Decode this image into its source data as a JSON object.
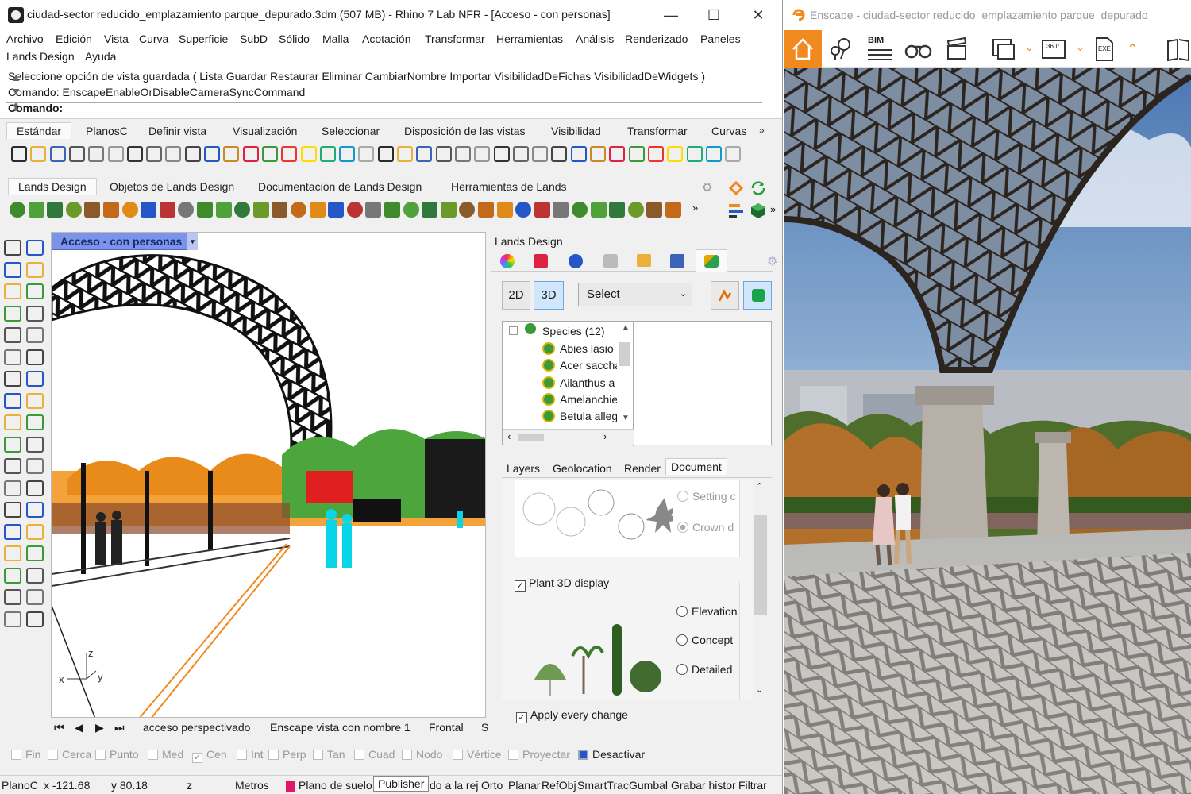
{
  "rhino": {
    "title": "ciudad-sector reducido_emplazamiento parque_depurado.3dm (507 MB) - Rhino 7 Lab NFR - [Acceso - con personas]",
    "window_controls": {
      "minimize": "—",
      "maximize": "☐",
      "close": "✕"
    },
    "menu": [
      "Archivo",
      "Edición",
      "Vista",
      "Curva",
      "Superficie",
      "SubD",
      "Sólido",
      "Malla",
      "Acotación",
      "Transformar",
      "Herramientas",
      "Análisis",
      "Renderizado",
      "Paneles",
      "Lands Design",
      "Ayuda"
    ],
    "command_history": [
      "Seleccione opción de vista guardada ( Lista  Guardar  Restaurar  Eliminar  CambiarNombre  Importar  VisibilidadDeFichas  VisibilidadDeWidgets )",
      "Comando: EnscapeEnableOrDisableCameraSyncCommand"
    ],
    "command_prompt": "Comando:",
    "toolbar_tabs": [
      "Estándar",
      "PlanosC",
      "Definir vista",
      "Visualización",
      "Seleccionar",
      "Disposición de las vistas",
      "Visibilidad",
      "Transformar",
      "Curvas"
    ],
    "toolbar_tabs_more": "»",
    "lands_tabs": [
      "Lands Design",
      "Objetos de Lands Design",
      "Documentación de Lands Design",
      "Herramientas de Lands"
    ],
    "lands_tabs_more": "»",
    "standard_icons": 38,
    "lands_icons": 36,
    "viewport": {
      "title": "Acceso - con personas",
      "dropdown": "▾",
      "axis_x": "x",
      "axis_y": "y",
      "axis_z": "z"
    },
    "viewport_nav": {
      "first": "⏮",
      "prev": "◀",
      "next": "▶",
      "last": "⏭",
      "tabs": [
        "acceso perspectivado",
        "Enscape vista con nombre 1",
        "Frontal",
        "S"
      ]
    },
    "osnaps": [
      {
        "label": "Fin",
        "checked": false
      },
      {
        "label": "Cerca",
        "checked": false
      },
      {
        "label": "Punto",
        "checked": false
      },
      {
        "label": "Med",
        "checked": false
      },
      {
        "label": "Cen",
        "checked": true
      },
      {
        "label": "Int",
        "checked": false
      },
      {
        "label": "Perp",
        "checked": false
      },
      {
        "label": "Tan",
        "checked": false
      },
      {
        "label": "Cuad",
        "checked": false
      },
      {
        "label": "Nodo",
        "checked": false
      },
      {
        "label": "Vértice",
        "checked": false
      },
      {
        "label": "Proyectar",
        "checked": false
      },
      {
        "label": "Desactivar",
        "checked": true
      }
    ],
    "status": {
      "cplane": "PlanoC",
      "x": "x -121.68",
      "y": "y 80.18",
      "z": "z",
      "units": "Metros",
      "layer": "Plano de suelo",
      "tooltip": "Publisher",
      "truncated": "do a la rej",
      "toggles": [
        "Orto",
        "Planar",
        "RefObj",
        "SmartTrac",
        "Gumbal",
        "Grabar histor",
        "Filtrar"
      ]
    }
  },
  "lands_panel": {
    "header": "Lands Design",
    "btn_2d": "2D",
    "btn_3d": "3D",
    "select_value": "Select",
    "species_root": "Species (12)",
    "species": [
      "Abies lasio",
      "Acer saccha",
      "Ailanthus a",
      "Amelanchie",
      "Betula alleg"
    ],
    "tabs": [
      "Layers",
      "Geolocation",
      "Render",
      "Document"
    ],
    "active_tab": "Document",
    "setting_label": "Setting c",
    "crown_label": "Crown d",
    "plant3d_label": "Plant 3D display",
    "plant3d_checked": true,
    "display_options": [
      "Elevation",
      "Concept",
      "Detailed"
    ],
    "apply_label": "Apply every change",
    "apply_checked": true
  },
  "enscape": {
    "title": "Enscape - ciudad-sector reducido_emplazamiento parque_depurado",
    "accent": "#f08a1e",
    "toolbar_icons": [
      "home-icon",
      "location-pins-icon",
      "bim-icon",
      "binoculars-icon",
      "clapperboard-icon",
      "batch-render-icon",
      "panorama-360-icon",
      "export-exe-icon",
      "collapse-icon",
      "book-icon"
    ],
    "bim_label": "BIM",
    "pano_label": "360°",
    "exe_label": "EXE"
  }
}
